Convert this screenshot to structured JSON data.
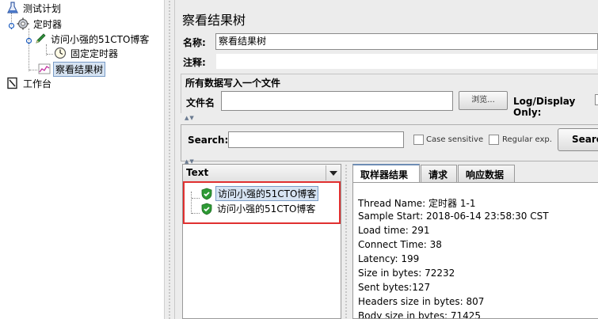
{
  "tree": {
    "items": [
      {
        "label": "测试计划",
        "icon": "test-plan-flask-icon"
      },
      {
        "label": "定时器",
        "icon": "thread-group-gear-icon"
      },
      {
        "label": "访问小强的51CTO博客",
        "icon": "http-sampler-pen-icon"
      },
      {
        "label": "固定定时器",
        "icon": "timer-clock-icon"
      },
      {
        "label": "察看结果树",
        "icon": "listener-chart-icon"
      },
      {
        "label": "工作台",
        "icon": "workbench-icon"
      }
    ]
  },
  "panel": {
    "title": "察看结果树",
    "name_label": "名称:",
    "name_value": "察看结果树",
    "comments_label": "注释:",
    "comments_value": "",
    "file_group_title": "所有数据写入一个文件",
    "filename_label": "文件名",
    "filename_value": "",
    "browse_label": "浏览...",
    "log_display_label": "Log/Display Only:"
  },
  "search": {
    "label": "Search:",
    "value": "",
    "case_sensitive_label": "Case sensitive",
    "regex_label": "Regular exp.",
    "button_label": "Search"
  },
  "results": {
    "renderer": "Text",
    "samples": [
      {
        "label": "访问小强的51CTO博客",
        "status": "success",
        "selected": true
      },
      {
        "label": "访问小强的51CTO博客",
        "status": "success",
        "selected": false
      }
    ]
  },
  "tabs": [
    {
      "label": "取样器结果",
      "active": true
    },
    {
      "label": "请求",
      "active": false
    },
    {
      "label": "响应数据",
      "active": false
    }
  ],
  "sampler_result": {
    "lines": [
      "Thread Name: 定时器 1-1",
      "Sample Start: 2018-06-14 23:58:30 CST",
      "Load time: 291",
      "Connect Time: 38",
      "Latency: 199",
      "Size in bytes: 72232",
      "Sent bytes:127",
      "Headers size in bytes: 807",
      "Body size in bytes: 71425"
    ]
  },
  "colors": {
    "highlight_box": "#e03030",
    "selection": "#d6e3f2",
    "success_shield": "#2e9a35"
  }
}
